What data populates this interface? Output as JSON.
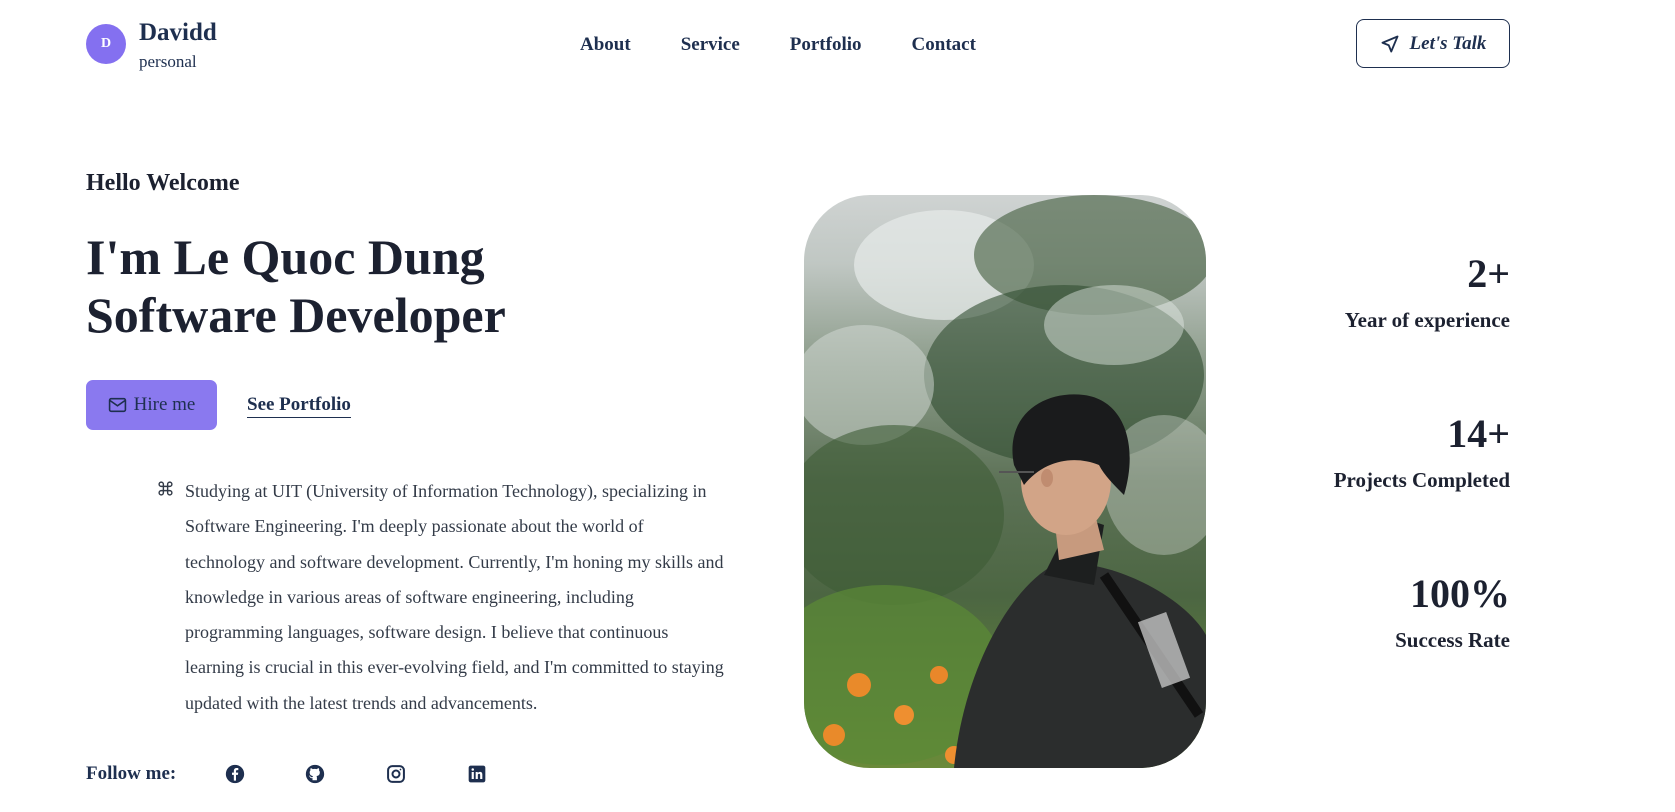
{
  "logo": {
    "initial": "D",
    "name": "Davidd",
    "subtitle": "personal"
  },
  "nav": {
    "items": [
      "About",
      "Service",
      "Portfolio",
      "Contact"
    ]
  },
  "header": {
    "cta_label": "Let's Talk"
  },
  "hero": {
    "greeting": "Hello Welcome",
    "title_line1": "I'm Le Quoc Dung",
    "title_line2": "Software Developer",
    "hire_label": "Hire me",
    "portfolio_label": "See Portfolio",
    "bio": "Studying at UIT (University of Information Technology), specializing in Software Engineering. I'm deeply passionate about the world of technology and software development. Currently, I'm honing my skills and knowledge in various areas of software engineering, including programming languages, software design. I believe that continuous learning is crucial in this ever-evolving field, and I'm committed to staying updated with the latest trends and advancements."
  },
  "social": {
    "label": "Follow me:",
    "icons": [
      "facebook-icon",
      "github-icon",
      "instagram-icon",
      "linkedin-icon"
    ]
  },
  "stats": [
    {
      "value": "2+",
      "label": "Year of experience"
    },
    {
      "value": "14+",
      "label": "Projects Completed"
    },
    {
      "value": "100%",
      "label": "Success Rate"
    }
  ],
  "colors": {
    "accent": "#8470f0",
    "primary_text": "#1e2f4f",
    "heading": "#1c2130"
  }
}
